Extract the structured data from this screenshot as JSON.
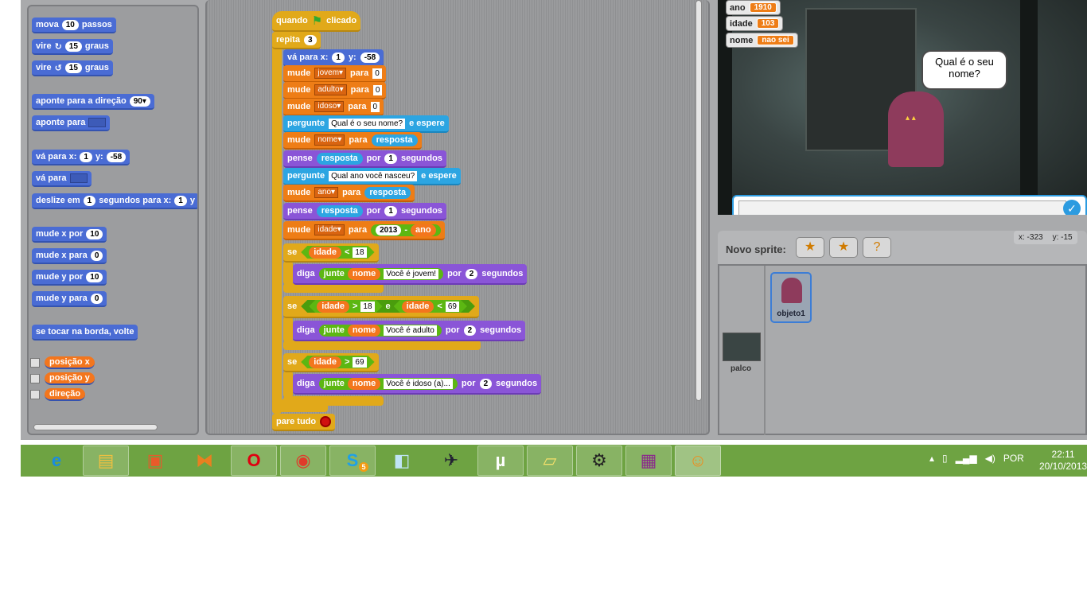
{
  "palette": {
    "items": [
      {
        "parts": [
          "mova",
          "10",
          "passos"
        ]
      },
      {
        "parts": [
          "vire",
          "↻",
          "15",
          "graus"
        ]
      },
      {
        "parts": [
          "vire",
          "↺",
          "15",
          "graus"
        ]
      },
      {
        "parts": [
          "aponte para a direção",
          "90▾"
        ]
      },
      {
        "parts": [
          "aponte para",
          ""
        ]
      },
      {
        "parts": [
          "vá para x:",
          "1",
          "y:",
          "-58"
        ]
      },
      {
        "parts": [
          "vá para",
          ""
        ]
      },
      {
        "parts": [
          "deslize em",
          "1",
          "segundos para x:",
          "1",
          "y"
        ]
      },
      {
        "parts": [
          "mude x por",
          "10"
        ]
      },
      {
        "parts": [
          "mude x para",
          "0"
        ]
      },
      {
        "parts": [
          "mude y por",
          "10"
        ]
      },
      {
        "parts": [
          "mude y para",
          "0"
        ]
      },
      {
        "parts": [
          "se tocar na borda, volte"
        ]
      }
    ],
    "reporters": [
      "posição x",
      "posição y",
      "direção"
    ]
  },
  "script": {
    "hat": {
      "label1": "quando",
      "label2": "clicado"
    },
    "repeat": {
      "label": "repita",
      "count": "3"
    },
    "goto": {
      "label": "vá para x:",
      "x": "1",
      "ylabel": "y:",
      "y": "-58"
    },
    "set1": {
      "label": "mude",
      "var": "jovem",
      "to": "para",
      "val": "0"
    },
    "set2": {
      "label": "mude",
      "var": "adulto",
      "to": "para",
      "val": "0"
    },
    "set3": {
      "label": "mude",
      "var": "idoso",
      "to": "para",
      "val": "0"
    },
    "ask1": {
      "label": "pergunte",
      "q": "Qual é o seu nome?",
      "wait": "e espere"
    },
    "set4": {
      "label": "mude",
      "var": "nome",
      "to": "para",
      "val": "resposta"
    },
    "think1": {
      "label": "pense",
      "val": "resposta",
      "por": "por",
      "secs": "1",
      "unit": "segundos"
    },
    "ask2": {
      "label": "pergunte",
      "q": "Qual ano você nasceu?",
      "wait": "e espere"
    },
    "set5": {
      "label": "mude",
      "var": "ano",
      "to": "para",
      "val": "resposta"
    },
    "think2": {
      "label": "pense",
      "val": "resposta",
      "por": "por",
      "secs": "1",
      "unit": "segundos"
    },
    "set6": {
      "label": "mude",
      "var": "idade",
      "to": "para",
      "num": "2013",
      "op": "-",
      "rhs": "ano"
    },
    "if1": {
      "label": "se",
      "var": "idade",
      "op": "<",
      "val": "18"
    },
    "say1": {
      "label": "diga",
      "join": "junte",
      "a": "nome",
      "b": "Você é jovem!",
      "por": "por",
      "secs": "2",
      "unit": "segundos"
    },
    "if2": {
      "label": "se",
      "var1": "idade",
      "op1": ">",
      "val1": "18",
      "and": "e",
      "var2": "idade",
      "op2": "<",
      "val2": "69"
    },
    "say2": {
      "label": "diga",
      "join": "junte",
      "a": "nome",
      "b": "Você é adulto",
      "por": "por",
      "secs": "2",
      "unit": "segundos"
    },
    "if3": {
      "label": "se",
      "var": "idade",
      "op": ">",
      "val": "69"
    },
    "say3": {
      "label": "diga",
      "join": "junte",
      "a": "nome",
      "b": "Você é idoso (a)...",
      "por": "por",
      "secs": "2",
      "unit": "segundos"
    },
    "stop": {
      "label": "pare tudo"
    }
  },
  "stage": {
    "monitors": [
      {
        "name": "ano",
        "value": "1910"
      },
      {
        "name": "idade",
        "value": "103"
      },
      {
        "name": "nome",
        "value": "nao sei"
      }
    ],
    "bubble": "Qual é o seu nome?",
    "ask_ok": "✓"
  },
  "sprites": {
    "new_sprite_label": "Novo sprite:",
    "coords": {
      "x": "x: -323",
      "y": "y: -15"
    },
    "stage_label": "palco",
    "sprite_name": "objeto1"
  },
  "taskbar": {
    "language": "POR",
    "time": "22:11",
    "date": "20/10/2013",
    "apps": [
      "internet-explorer",
      "file-explorer",
      "paint",
      "media-app",
      "opera",
      "chrome",
      "skype",
      "notepad",
      "flight-app",
      "utorrent",
      "sticky-notes",
      "steam",
      "winrar",
      "scratch"
    ],
    "skype_badge": "5"
  }
}
